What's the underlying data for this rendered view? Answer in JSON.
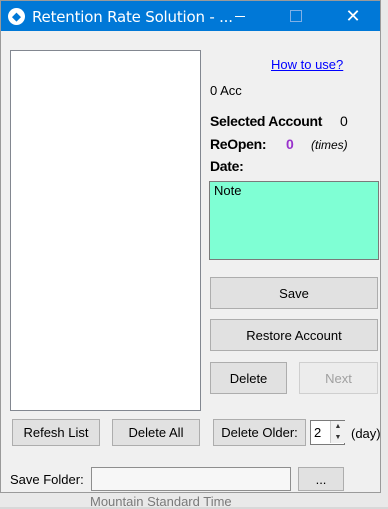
{
  "window": {
    "title": "Retention Rate Solution - ...",
    "minimize": "",
    "maximize": "",
    "close": "✕"
  },
  "background_text": "Mountain Standard Time",
  "info": {
    "how_to_use": "How to use?",
    "acc_count": "0 Acc",
    "selected_account_label": "Selected Account",
    "selected_account_value": "0",
    "reopen_label": "ReOpen:",
    "reopen_value": "0",
    "reopen_unit": "(times)",
    "date_label": "Date:",
    "date_value": "",
    "note_text": "Note"
  },
  "buttons": {
    "save": "Save",
    "restore": "Restore Account",
    "delete": "Delete",
    "next": "Next",
    "refresh_list": "Refesh List",
    "delete_all": "Delete All",
    "delete_older": "Delete Older:",
    "browse": "..."
  },
  "delete_older": {
    "days_value": "2",
    "unit": "(day)"
  },
  "save_folder": {
    "label": "Save Folder:",
    "value": ""
  },
  "colors": {
    "titlebar": "#0078d7",
    "note_bg": "#7fffd4",
    "reopen_value": "#9932cc",
    "link": "#0000ff"
  }
}
